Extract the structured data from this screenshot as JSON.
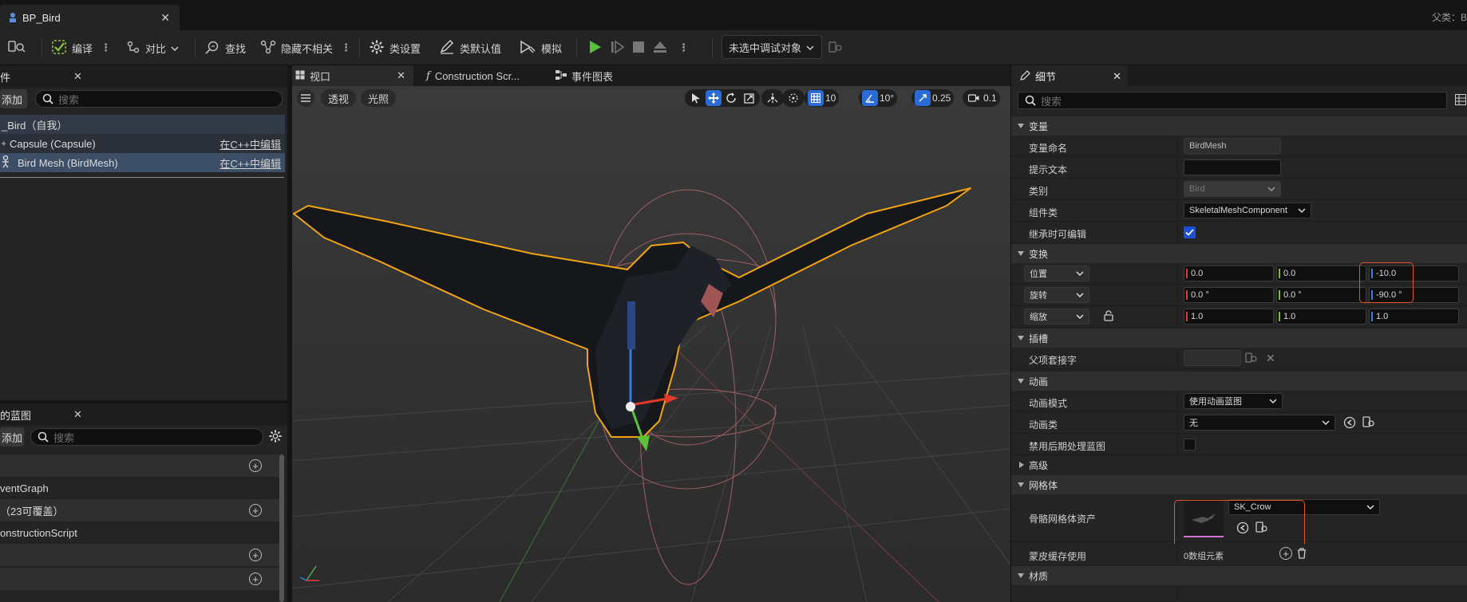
{
  "tab": {
    "title": "BP_Bird",
    "parent_label": "父类：B"
  },
  "toolbar": {
    "compile": "编译",
    "diff": "对比",
    "find": "查找",
    "hide_unrelated": "隐藏不相关",
    "class_settings": "类设置",
    "class_defaults": "类默认值",
    "simulate": "模拟",
    "debug_object": "未选中调试对象"
  },
  "components": {
    "title": "件",
    "add": "添加",
    "search_placeholder": "搜索",
    "items": [
      {
        "label": "_Bird（自我）"
      },
      {
        "label": "Capsule (Capsule)",
        "edit": "在C++中编辑"
      },
      {
        "label": "Bird Mesh (BirdMesh)",
        "edit": "在C++中编辑"
      }
    ]
  },
  "my_blueprint": {
    "title": "的蓝图",
    "add": "添加",
    "search_placeholder": "搜索",
    "rows": [
      {
        "label": ""
      },
      {
        "label": "ventGraph"
      },
      {
        "label": "（23可覆盖）"
      },
      {
        "label": "onstructionScript"
      },
      {
        "label": ""
      },
      {
        "label": ""
      }
    ]
  },
  "viewport": {
    "tabs": [
      "视口",
      "Construction Scr...",
      "事件图表"
    ],
    "perspective": "透视",
    "lit": "光照",
    "grid_snap": "10",
    "rot_snap": "10°",
    "scale_snap": "0.25",
    "cam_speed": "0.1"
  },
  "details": {
    "title": "细节",
    "search_placeholder": "搜索",
    "sections": {
      "variable": "变量",
      "transform": "变换",
      "sockets": "插槽",
      "animation": "动画",
      "advanced": "高级",
      "mesh": "网格体",
      "materials": "材质"
    },
    "variable": {
      "name_label": "变量命名",
      "name_value": "BirdMesh",
      "tooltip_label": "提示文本",
      "tooltip_value": "",
      "category_label": "类别",
      "category_value": "Bird",
      "component_class_label": "组件类",
      "component_class_value": "SkeletalMeshComponent",
      "editable_label": "继承时可编辑",
      "editable_checked": true
    },
    "transform": {
      "location": {
        "label": "位置",
        "x": "0.0",
        "y": "0.0",
        "z": "-10.0"
      },
      "rotation": {
        "label": "旋转",
        "x": "0.0 °",
        "y": "0.0 °",
        "z": "-90.0 °"
      },
      "scale": {
        "label": "缩放",
        "x": "1.0",
        "y": "1.0",
        "z": "1.0"
      }
    },
    "sockets": {
      "parent_socket_label": "父项套接字",
      "parent_socket_value": ""
    },
    "animation": {
      "mode_label": "动画模式",
      "mode_value": "使用动画蓝图",
      "class_label": "动画类",
      "class_value": "无",
      "disable_post_label": "禁用后期处理蓝图"
    },
    "mesh": {
      "asset_label": "骨骼网格体资产",
      "asset_value": "SK_Crow",
      "skin_cache_label": "蒙皮缓存使用",
      "skin_cache_value": "0数组元素"
    }
  },
  "colors": {
    "accent_blue": "#2a6bd6",
    "selection_orange": "#f2a413",
    "highlight_red": "#e4532a",
    "play_green": "#56c23a"
  }
}
